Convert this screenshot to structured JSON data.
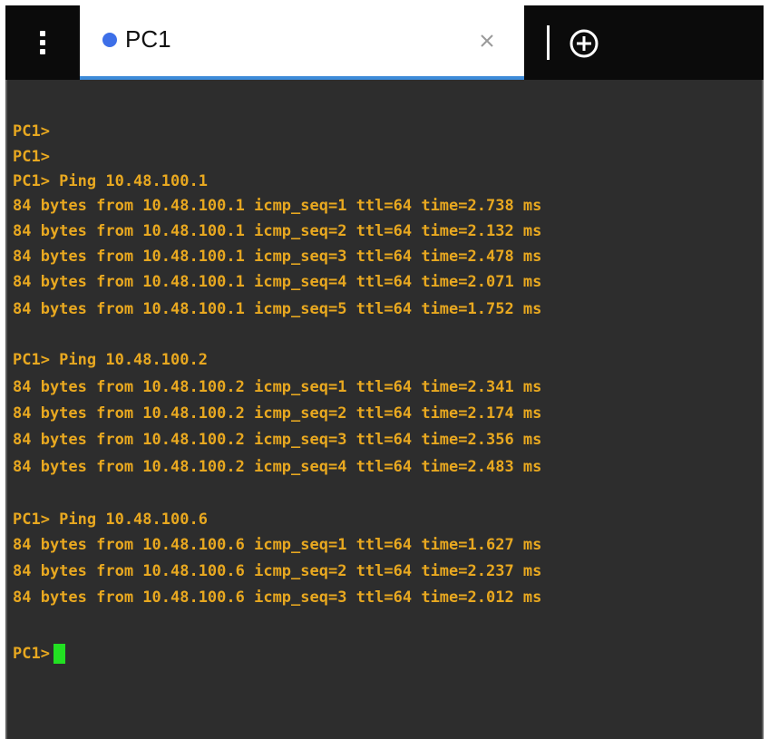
{
  "tab": {
    "title": "PC1",
    "status_color": "#3d6fe8",
    "close_icon": "close-icon",
    "add_icon": "add-tab-icon",
    "menu_icon": "vertical-ellipsis-icon"
  },
  "colors": {
    "terminal_bg": "#2d2d2d",
    "text": "#e8a820",
    "cursor": "#22e022",
    "tab_underline": "#3d8bd9"
  },
  "terminal": {
    "lines": [
      "PC1>",
      "PC1>",
      "PC1> Ping 10.48.100.1",
      "84 bytes from 10.48.100.1 icmp_seq=1 ttl=64 time=2.738 ms",
      "84 bytes from 10.48.100.1 icmp_seq=2 ttl=64 time=2.132 ms",
      "84 bytes from 10.48.100.1 icmp_seq=3 ttl=64 time=2.478 ms",
      "84 bytes from 10.48.100.1 icmp_seq=4 ttl=64 time=2.071 ms",
      "84 bytes from 10.48.100.1 icmp_seq=5 ttl=64 time=1.752 ms",
      "PC1> Ping 10.48.100.2",
      "84 bytes from 10.48.100.2 icmp_seq=1 ttl=64 time=2.341 ms",
      "84 bytes from 10.48.100.2 icmp_seq=2 ttl=64 time=2.174 ms",
      "84 bytes from 10.48.100.2 icmp_seq=3 ttl=64 time=2.356 ms",
      "84 bytes from 10.48.100.2 icmp_seq=4 ttl=64 time=2.483 ms",
      "PC1> Ping 10.48.100.6",
      "84 bytes from 10.48.100.6 icmp_seq=1 ttl=64 time=1.627 ms",
      "84 bytes from 10.48.100.6 icmp_seq=2 ttl=64 time=2.237 ms",
      "84 bytes from 10.48.100.6 icmp_seq=3 ttl=64 time=2.012 ms"
    ],
    "prompt": "PC1>"
  }
}
